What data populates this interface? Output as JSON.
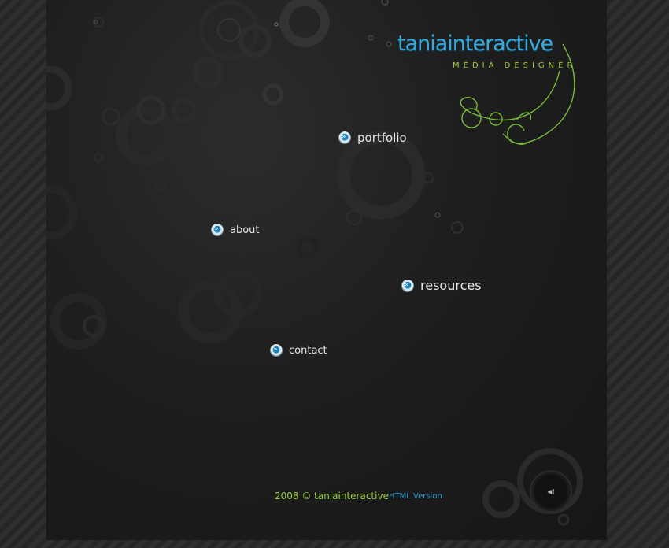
{
  "brand": {
    "name": "taniainteractive",
    "tagline": "MEDIA DESIGNER",
    "accent_blue": "#3aa7d8",
    "accent_green": "#9ccf3c"
  },
  "nav": {
    "portfolio": "portfolio",
    "about": "about",
    "resources": "resources",
    "contact": "contact"
  },
  "footer": {
    "copyright": "2008 © taniainteractive",
    "html_version": "HTML Version"
  },
  "controls": {
    "sound_icon": "speaker-icon",
    "sound_glyph": "◂ı"
  }
}
